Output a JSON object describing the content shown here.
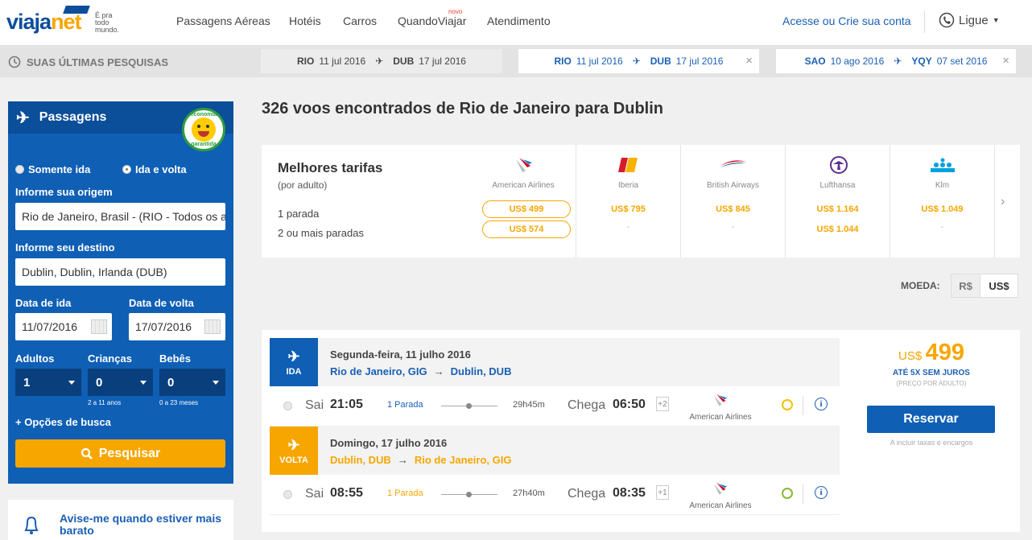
{
  "header": {
    "logo_main": "viaja",
    "logo_accent": "net",
    "tagline": "É pra todo mundo.",
    "nav": [
      "Passagens Aéreas",
      "Hotéis",
      "Carros",
      "QuandoViajar",
      "Atendimento"
    ],
    "nav_badge": "novo",
    "account": "Acesse ou Crie sua conta",
    "phone": "Ligue"
  },
  "recent": {
    "title": "SUAS ÚLTIMAS PESQUISAS",
    "searches": [
      {
        "from": "RIO",
        "from_date": "11 jul 2016",
        "to": "DUB",
        "to_date": "17 jul 2016"
      },
      {
        "from": "RIO",
        "from_date": "11 jul 2016",
        "to": "DUB",
        "to_date": "17 jul 2016"
      },
      {
        "from": "SAO",
        "from_date": "10 ago 2016",
        "to": "YQY",
        "to_date": "07 set 2016"
      }
    ]
  },
  "sidebar": {
    "title": "Passagens",
    "badge_top": "economia",
    "badge_bottom": "garantida",
    "trip_one_way": "Somente ida",
    "trip_round": "Ida e volta",
    "origin_label": "Informe sua origem",
    "origin_value": "Rio de Janeiro, Brasil - (RIO - Todos os aeroportos)",
    "dest_label": "Informe seu destino",
    "dest_value": "Dublin, Dublin, Irlanda (DUB)",
    "depart_label": "Data de ida",
    "depart_value": "11/07/2016",
    "return_label": "Data de volta",
    "return_value": "17/07/2016",
    "adults_label": "Adultos",
    "adults_value": "1",
    "children_label": "Crianças",
    "children_value": "0",
    "children_hint": "2 a 11 anos",
    "babies_label": "Bebês",
    "babies_value": "0",
    "babies_hint": "0 a 23 meses",
    "options": "+ Opções de busca",
    "search_button": "Pesquisar"
  },
  "alert": {
    "text": "Avise-me quando estiver mais barato"
  },
  "results": {
    "heading": "326 voos encontrados de Rio de Janeiro para Dublin"
  },
  "fares": {
    "title": "Melhores tarifas",
    "subtitle": "(por adulto)",
    "row1": "1 parada",
    "row2": "2 ou mais paradas",
    "airlines": [
      {
        "name": "American Airlines",
        "p1": "US$ 499",
        "p2": "US$ 574"
      },
      {
        "name": "Iberia",
        "p1": "US$ 795",
        "p2": "-"
      },
      {
        "name": "British Airways",
        "p1": "US$ 845",
        "p2": "-"
      },
      {
        "name": "Lufthansa",
        "p1": "US$ 1.164",
        "p2": "US$ 1.044"
      },
      {
        "name": "Klm",
        "p1": "US$ 1.049",
        "p2": "-"
      }
    ]
  },
  "currency": {
    "label": "MOEDA:",
    "brl": "R$",
    "usd": "US$"
  },
  "flight": {
    "outbound": {
      "tag": "IDA",
      "date": "Segunda-feira, 11 julho 2016",
      "from": "Rio de Janeiro, GIG",
      "to": "Dublin, DUB",
      "depart_label": "Sai",
      "depart_time": "21:05",
      "stops": "1 Parada",
      "duration": "29h45m",
      "arrive_label": "Chega",
      "arrive_time": "06:50",
      "day_offset": "+2",
      "airline": "American Airlines"
    },
    "return": {
      "tag": "VOLTA",
      "date": "Domingo, 17 julho 2016",
      "from": "Dublin, DUB",
      "to": "Rio de Janeiro, GIG",
      "depart_label": "Sai",
      "depart_time": "08:55",
      "stops": "1 Parada",
      "duration": "27h40m",
      "arrive_label": "Chega",
      "arrive_time": "08:35",
      "day_offset": "+1",
      "airline": "American Airlines"
    },
    "price_currency": "US$",
    "price": "499",
    "installments": "ATÉ 5X SEM JUROS",
    "per_adult": "(PREÇO POR ADULTO)",
    "reserve": "Reservar",
    "taxes": "A incluir taxas e encargos"
  },
  "colors": {
    "brand_blue": "#0f5fb5",
    "accent_orange": "#f7a600",
    "link_blue": "#1a5fb4"
  }
}
